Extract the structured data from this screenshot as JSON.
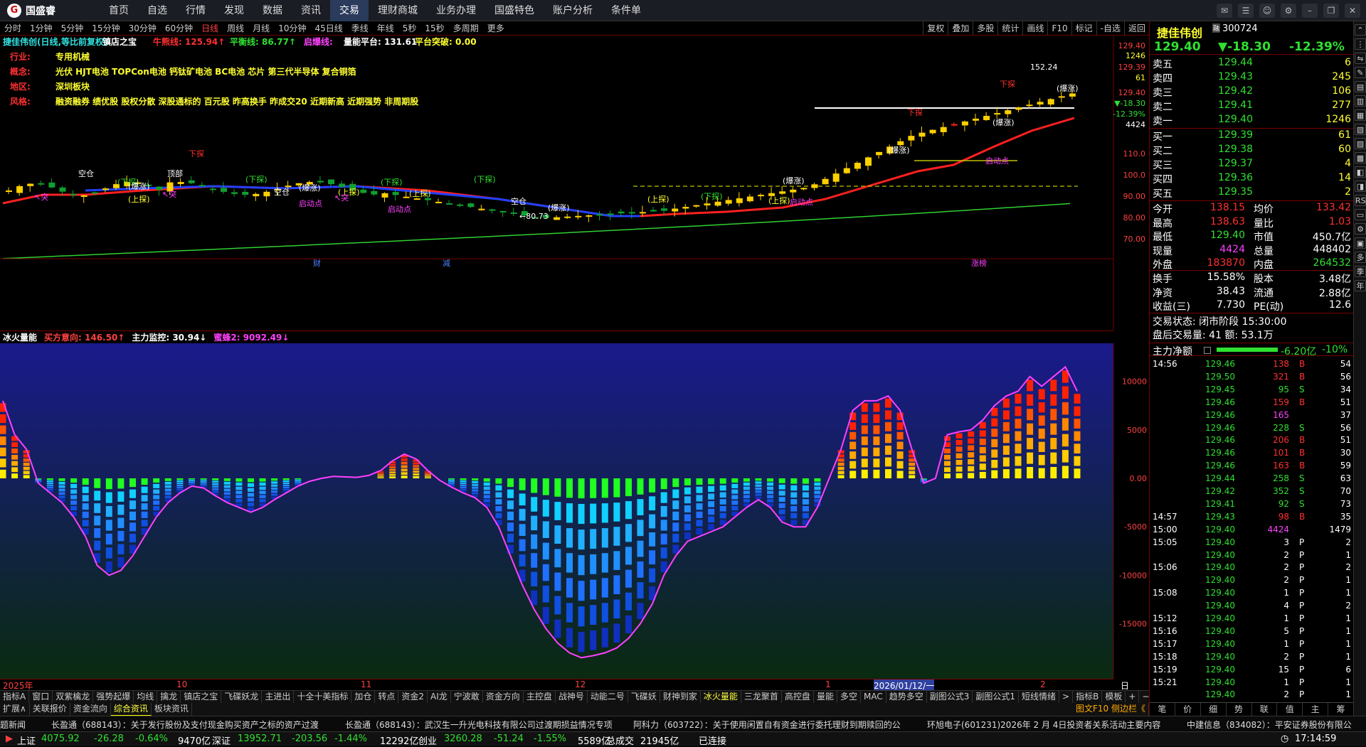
{
  "app": {
    "logo_text": "国盛睿",
    "logo_icon": "G"
  },
  "menu": [
    "首页",
    "自选",
    "行情",
    "发现",
    "数据",
    "资讯",
    "交易",
    "理财商城",
    "业务办理",
    "国盛特色",
    "账户分析",
    "条件单"
  ],
  "menu_active": "交易",
  "toolbar": [
    "分时",
    "1分钟",
    "5分钟",
    "15分钟",
    "30分钟",
    "60分钟",
    "日线",
    "周线",
    "月线",
    "10分钟",
    "45日线",
    "季线",
    "年线",
    "5秒",
    "15秒",
    "多周期",
    "更多"
  ],
  "toolbar_active": "日线",
  "toolbar_right": [
    "复权",
    "叠加",
    "多股",
    "统计",
    "画线",
    "F10",
    "标记",
    "-自选",
    "返回"
  ],
  "chart_header": {
    "title": "捷佳伟创(日线,等比前复权)",
    "indicator": "镇店之宝",
    "items": [
      {
        "label": "牛熊线: 125.94↑",
        "color": "#ff3030"
      },
      {
        "label": "平衡线: 86.77↑",
        "color": "#30e030"
      },
      {
        "label": "启爆线:",
        "color": "#ff40ff"
      },
      {
        "label": "量能平台: 131.61",
        "color": "#fff"
      },
      {
        "label": "平台突破: 0.00",
        "color": "#ffff30"
      }
    ]
  },
  "info_box": [
    {
      "key": "行业:",
      "value": "专用机械"
    },
    {
      "key": "概念:",
      "value": "光伏 HJT电池 TOPCon电池 钙钛矿电池 BC电池 芯片 第三代半导体 复合铜箔"
    },
    {
      "key": "地区:",
      "value": "深圳板块"
    },
    {
      "key": "风格:",
      "value": "融资融券 绩优股 股权分散 深股通标的 百元股 昨高换手 昨成交20 近期新高 近期强势 非周期股"
    }
  ],
  "y_axis_main": [
    "129.40",
    "1246",
    "129.39",
    "61",
    "129.40",
    "▼-18.30",
    "-12.39%",
    "4424",
    "110.0",
    "100.0",
    "90.00",
    "80.00",
    "70.00"
  ],
  "y_axis_top": "129.40",
  "chart_data": [
    {
      "type": "line",
      "title": "",
      "x_label_markers": [
        "2025年",
        "10",
        "11",
        "12",
        "1",
        "2026/01/12/一",
        "2"
      ],
      "series": [
        {
          "name": "牛熊线",
          "color": "#ff2020"
        },
        {
          "name": "平衡线",
          "color": "#30d030"
        }
      ],
      "annotations": [
        "152.24",
        "←80.73",
        "空仓",
        "(上探)",
        "(下探)",
        "下探",
        "(爆涨)",
        "启动点",
        "突",
        "突破",
        "顶部",
        "财",
        "减",
        "涨榜"
      ],
      "ylim": [
        70,
        152.24
      ]
    },
    {
      "type": "bar",
      "title": "冰火量能",
      "series_labels": [
        {
          "label": "买方意向: 146.50↑",
          "color": "#ff4040"
        },
        {
          "label": "主力监控: 30.94↓",
          "color": "#fff"
        },
        {
          "label": "蜜蜂2: 9092.49↓",
          "color": "#ff40ff"
        }
      ],
      "values": [
        8000,
        4500,
        3000,
        -500,
        -1500,
        -2500,
        -4000,
        -6000,
        -9000,
        -10000,
        -9500,
        -8000,
        -6000,
        -4000,
        -2500,
        -1500,
        -800,
        -1000,
        -1800,
        -2500,
        -3000,
        -3500,
        -3000,
        -2200,
        -1500,
        -800,
        -300,
        0,
        200,
        150,
        100,
        300,
        800,
        1800,
        2500,
        2000,
        800,
        -200,
        -900,
        -1500,
        -2000,
        -3000,
        -5000,
        -8000,
        -11000,
        -13500,
        -15500,
        -17000,
        -18000,
        -18500,
        -18300,
        -18000,
        -17500,
        -16500,
        -15000,
        -13000,
        -10000,
        -8000,
        -6500,
        -6000,
        -5500,
        -5000,
        -4000,
        -3000,
        -2200,
        -3000,
        -4500,
        -5000,
        -5000,
        -3000,
        0,
        3000,
        7000,
        8000,
        8000,
        8500,
        7000,
        3000,
        -500,
        0,
        4500,
        4800,
        5000,
        6000,
        7500,
        8500,
        9000,
        10500,
        9500,
        10500,
        11500,
        9000
      ],
      "ylim": [
        -20000,
        12000
      ],
      "y_ticks": [
        "10000",
        "5000",
        "0.00",
        "-5000",
        "-10000",
        "-15000"
      ]
    }
  ],
  "quote": {
    "name": "捷佳伟创",
    "code": "300724",
    "badge": "融",
    "price": "129.40",
    "change": "▼-18.30",
    "pct": "-12.39%",
    "asks": [
      {
        "label": "卖五",
        "price": "129.44",
        "vol": "6"
      },
      {
        "label": "卖四",
        "price": "129.43",
        "vol": "245"
      },
      {
        "label": "卖三",
        "price": "129.42",
        "vol": "106"
      },
      {
        "label": "卖二",
        "price": "129.41",
        "vol": "277"
      },
      {
        "label": "卖一",
        "price": "129.40",
        "vol": "1246"
      }
    ],
    "bids": [
      {
        "label": "买一",
        "price": "129.39",
        "vol": "61"
      },
      {
        "label": "买二",
        "price": "129.38",
        "vol": "60"
      },
      {
        "label": "买三",
        "price": "129.37",
        "vol": "4"
      },
      {
        "label": "买四",
        "price": "129.36",
        "vol": "14"
      },
      {
        "label": "买五",
        "price": "129.35",
        "vol": "2"
      }
    ],
    "stats": [
      {
        "l1": "今开",
        "v1": "138.15",
        "l2": "均价",
        "v2": "133.42",
        "c1": "red",
        "c2": "red"
      },
      {
        "l1": "最高",
        "v1": "138.63",
        "l2": "量比",
        "v2": "1.03",
        "c1": "red",
        "c2": "red"
      },
      {
        "l1": "最低",
        "v1": "129.40",
        "l2": "市值",
        "v2": "450.7亿",
        "c1": "grn",
        "c2": "wht"
      },
      {
        "l1": "现量",
        "v1": "4424",
        "l2": "总量",
        "v2": "448402",
        "c1": "mag",
        "c2": "wht"
      },
      {
        "l1": "外盘",
        "v1": "183870",
        "l2": "内盘",
        "v2": "264532",
        "c1": "red",
        "c2": "grn"
      }
    ],
    "stats2": [
      {
        "l1": "换手",
        "v1": "15.58%",
        "l2": "股本",
        "v2": "3.48亿"
      },
      {
        "l1": "净资",
        "v1": "38.43",
        "l2": "流通",
        "v2": "2.88亿"
      },
      {
        "l1": "收益(三)",
        "v1": "7.730",
        "l2": "PE(动)",
        "v2": "12.6"
      }
    ],
    "trade_status": "交易状态: 闭市阶段 15:30:00",
    "after_hours": "盘后交易量: 41  额: 53.1万",
    "net_flow_label": "主力净额",
    "net_flow_value": "-6.20亿",
    "net_flow_pct": "-10%"
  },
  "ticks": [
    {
      "t": "14:56",
      "p": "129.46",
      "v": "138",
      "d": "B",
      "n": "54"
    },
    {
      "t": "",
      "p": "129.50",
      "v": "321",
      "d": "B",
      "n": "56"
    },
    {
      "t": "",
      "p": "129.45",
      "v": "95",
      "d": "S",
      "n": "34"
    },
    {
      "t": "",
      "p": "129.46",
      "v": "159",
      "d": "B",
      "n": "51"
    },
    {
      "t": "",
      "p": "129.46",
      "v": "165",
      "d": "",
      "n": "37"
    },
    {
      "t": "",
      "p": "129.46",
      "v": "228",
      "d": "S",
      "n": "56"
    },
    {
      "t": "",
      "p": "129.46",
      "v": "206",
      "d": "B",
      "n": "51"
    },
    {
      "t": "",
      "p": "129.46",
      "v": "101",
      "d": "B",
      "n": "30"
    },
    {
      "t": "",
      "p": "129.46",
      "v": "163",
      "d": "B",
      "n": "59"
    },
    {
      "t": "",
      "p": "129.44",
      "v": "258",
      "d": "S",
      "n": "63"
    },
    {
      "t": "",
      "p": "129.42",
      "v": "352",
      "d": "S",
      "n": "70"
    },
    {
      "t": "",
      "p": "129.41",
      "v": "92",
      "d": "S",
      "n": "73"
    },
    {
      "t": "14:57",
      "p": "129.43",
      "v": "98",
      "d": "B",
      "n": "35"
    },
    {
      "t": "15:00",
      "p": "129.40",
      "v": "4424",
      "d": "",
      "n": "1479"
    },
    {
      "t": "15:05",
      "p": "129.40",
      "v": "3",
      "d": "P",
      "n": "2"
    },
    {
      "t": "",
      "p": "129.40",
      "v": "2",
      "d": "P",
      "n": "1"
    },
    {
      "t": "15:06",
      "p": "129.40",
      "v": "2",
      "d": "P",
      "n": "2"
    },
    {
      "t": "",
      "p": "129.40",
      "v": "2",
      "d": "P",
      "n": "1"
    },
    {
      "t": "15:08",
      "p": "129.40",
      "v": "1",
      "d": "P",
      "n": "1"
    },
    {
      "t": "",
      "p": "129.40",
      "v": "4",
      "d": "P",
      "n": "2"
    },
    {
      "t": "15:12",
      "p": "129.40",
      "v": "1",
      "d": "P",
      "n": "1"
    },
    {
      "t": "15:16",
      "p": "129.40",
      "v": "5",
      "d": "P",
      "n": "1"
    },
    {
      "t": "15:17",
      "p": "129.40",
      "v": "1",
      "d": "P",
      "n": "1"
    },
    {
      "t": "15:18",
      "p": "129.40",
      "v": "2",
      "d": "P",
      "n": "1"
    },
    {
      "t": "15:19",
      "p": "129.40",
      "v": "15",
      "d": "P",
      "n": "6"
    },
    {
      "t": "15:21",
      "p": "129.40",
      "v": "1",
      "d": "P",
      "n": "1"
    },
    {
      "t": "",
      "p": "129.40",
      "v": "2",
      "d": "P",
      "n": "1"
    }
  ],
  "panel_tabs": [
    "笔",
    "价",
    "细",
    "势",
    "联",
    "值",
    "主",
    "筹"
  ],
  "side_icons": [
    "⌃",
    "⋮",
    "⇋",
    "✎",
    "▤",
    "▥",
    "▦",
    "▧",
    "▨",
    "▩",
    "◧",
    "◨",
    "RSI",
    "▭",
    "⚙",
    "▣",
    "多",
    "季",
    "年"
  ],
  "tabs_row1": [
    "指标A",
    "窗口",
    "双紫檎龙",
    "强势起爆",
    "均线",
    "擒龙",
    "镇店之宝",
    "飞碟妖龙",
    "主进出",
    "十全十美指标",
    "加仓",
    "转点",
    "资金2",
    "AI龙",
    "宁波敢",
    "资金方向",
    "主控盘",
    "战神号",
    "动能二号",
    "飞碟妖",
    "财神到家",
    "冰火量能",
    "三龙聚首",
    "高控盘",
    "量能",
    "多空",
    "MAC",
    "趋势多空",
    "副图公式3",
    "副图公式1",
    "短线情绪",
    ">",
    "指标B",
    "模板",
    "+",
    "−"
  ],
  "tabs_row1_active": "冰火量能",
  "tabs_row2": [
    "扩展∧",
    "关联报价",
    "资金流向",
    "综合资讯",
    "板块资讯"
  ],
  "tabs_row2_active": "综合资讯",
  "tabs_row2_right": "图文F10 侧边栏《",
  "y_axis_label": "日线",
  "news": [
    "题新闻",
    "长盈通（688143）：关于发行股份及支付现金购买资产之标的资产过渡",
    "长盈通（688143）：武汉生一升光电科技有限公司过渡期损益情况专项",
    "阿科力（603722）：关于使用闲置自有资金进行委托理财到期赎回的公",
    "环旭电子(601231)2026年 2 月 4日投资者关系活动主要内容",
    "中建信息（834082）：平安证券股份有限公"
  ],
  "status": {
    "idx1": "上证",
    "idx1_v": "4075.92",
    "idx1_c": "-26.28",
    "idx1_p": "-0.64%",
    "idx1_a": "9470亿",
    "idx2": "深证",
    "idx2_v": "13952.71",
    "idx2_c": "-203.56",
    "idx2_p": "-1.44%",
    "idx2_a": "12292亿",
    "idx3": "创业",
    "idx3_v": "3260.28",
    "idx3_c": "-51.24",
    "idx3_p": "-1.55%",
    "idx3_a": "5589亿",
    "total_label": "总成交",
    "total": "21945亿",
    "conn": "已连接",
    "time": "17:14:59"
  }
}
